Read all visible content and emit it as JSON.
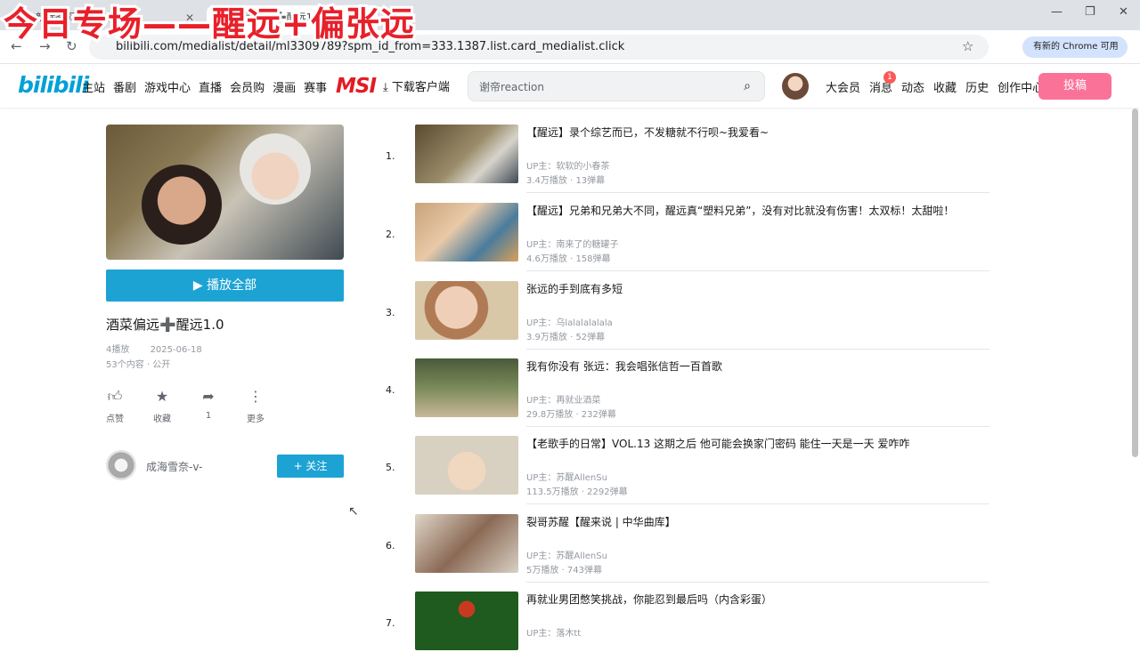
{
  "browser": {
    "tabs": [
      {
        "label": "新标签页 | 专题中心"
      },
      {
        "label": "酒菜偏远➕醒远1.0"
      }
    ],
    "url": "bilibili.com/medialist/detail/ml3309789?spm_id_from=333.1387.list.card_medialist.click",
    "profile_chip": "有新的 Chrome 可用"
  },
  "overlay_caption": "今日专场——醒远+偏张远",
  "header": {
    "logo": "bilibili",
    "nav": [
      "主站",
      "番剧",
      "游戏中心",
      "直播",
      "会员购",
      "漫画",
      "赛事"
    ],
    "msi": "MSI",
    "download": "下载客户端",
    "search_placeholder": "谢帝reaction",
    "right_nav": [
      "大会员",
      "消息",
      "动态",
      "收藏",
      "历史",
      "创作中心"
    ],
    "message_badge": "1",
    "upload": "投稿"
  },
  "playlist": {
    "play_all": "播放全部",
    "title": "酒菜偏远➕醒远1.0",
    "plays": "4播放",
    "date": "2025-06-18",
    "count_visibility": "53个内容 · 公开",
    "actions": [
      {
        "icon": "thumbs-up-icon",
        "label": "点赞"
      },
      {
        "icon": "star-icon",
        "label": "收藏"
      },
      {
        "icon": "share-icon",
        "label": "1"
      },
      {
        "icon": "more-icon",
        "label": "更多"
      }
    ],
    "owner": "成海雪奈-v-",
    "follow": "+ 关注"
  },
  "videos": [
    {
      "num": "1.",
      "title": "【醒远】录个综艺而已，不发糖就不行呗~我爱看~",
      "up": "UP主：软软的小春茶",
      "stats": "3.4万播放 · 13弹幕"
    },
    {
      "num": "2.",
      "title": "【醒远】兄弟和兄弟大不同，醒远真“塑料兄弟”，没有对比就没有伤害！太双标！太甜啦！",
      "up": "UP主：南来了的糖罐子",
      "stats": "4.6万播放 · 158弹幕"
    },
    {
      "num": "3.",
      "title": "张远的手到底有多短",
      "up": "UP主：乌lalalalalala",
      "stats": "3.9万播放 · 52弹幕"
    },
    {
      "num": "4.",
      "title": "我有你没有 张远：我会唱张信哲一百首歌",
      "up": "UP主：再就业酒菜",
      "stats": "29.8万播放 · 232弹幕"
    },
    {
      "num": "5.",
      "title": "【老歌手的日常】VOL.13 这期之后 他可能会换家门密码 能住一天是一天 爱咋咋",
      "up": "UP主：苏醒AllenSu",
      "stats": "113.5万播放 · 2292弹幕"
    },
    {
      "num": "6.",
      "title": "裂哥苏醒【醒来说 | 中华曲库】",
      "up": "UP主：苏醒AllenSu",
      "stats": "5万播放 · 743弹幕"
    },
    {
      "num": "7.",
      "title": "再就业男团憋笑挑战，你能忍到最后吗（内含彩蛋）",
      "up": "UP主：落木tt",
      "stats": ""
    }
  ]
}
